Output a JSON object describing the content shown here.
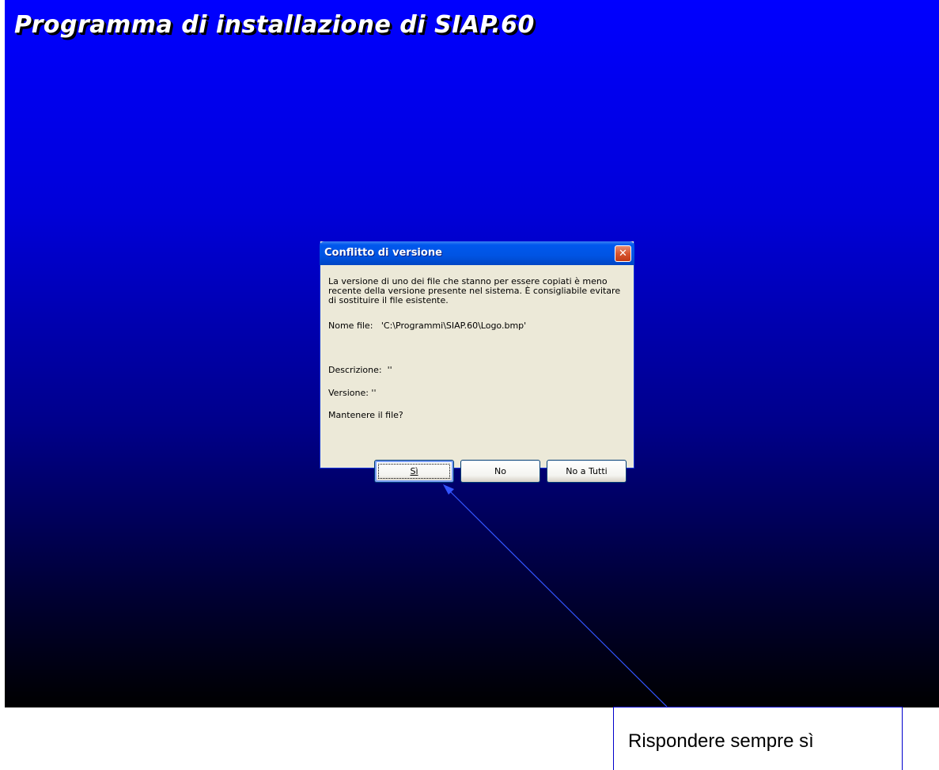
{
  "banner": {
    "title": "Programma di installazione di SIAP.60"
  },
  "dialog": {
    "title": "Conflitto di versione",
    "close_icon": "close-icon",
    "message": "La versione di uno dei file che stanno per essere copiati è meno recente della versione presente nel sistema. È consigliabile evitare di sostituire il file esistente.",
    "file_label": "Nome file:",
    "file_value": "'C:\\Programmi\\SIAP.60\\Logo.bmp'",
    "description": "Descrizione:  ''",
    "version": "Versione: ''",
    "question": "Mantenere il file?",
    "buttons": [
      {
        "label": "Sì",
        "default": true
      },
      {
        "label": "No"
      },
      {
        "label": "No a Tutti"
      }
    ]
  },
  "annotation": {
    "text": "Rispondere sempre sì",
    "color": "#3355ff"
  },
  "colors": {
    "desktop_top": "#0000ff",
    "desktop_bottom": "#000000",
    "dialog_face": "#ece9d8",
    "titlebar": "#0054e3",
    "close_button": "#d8552f"
  }
}
